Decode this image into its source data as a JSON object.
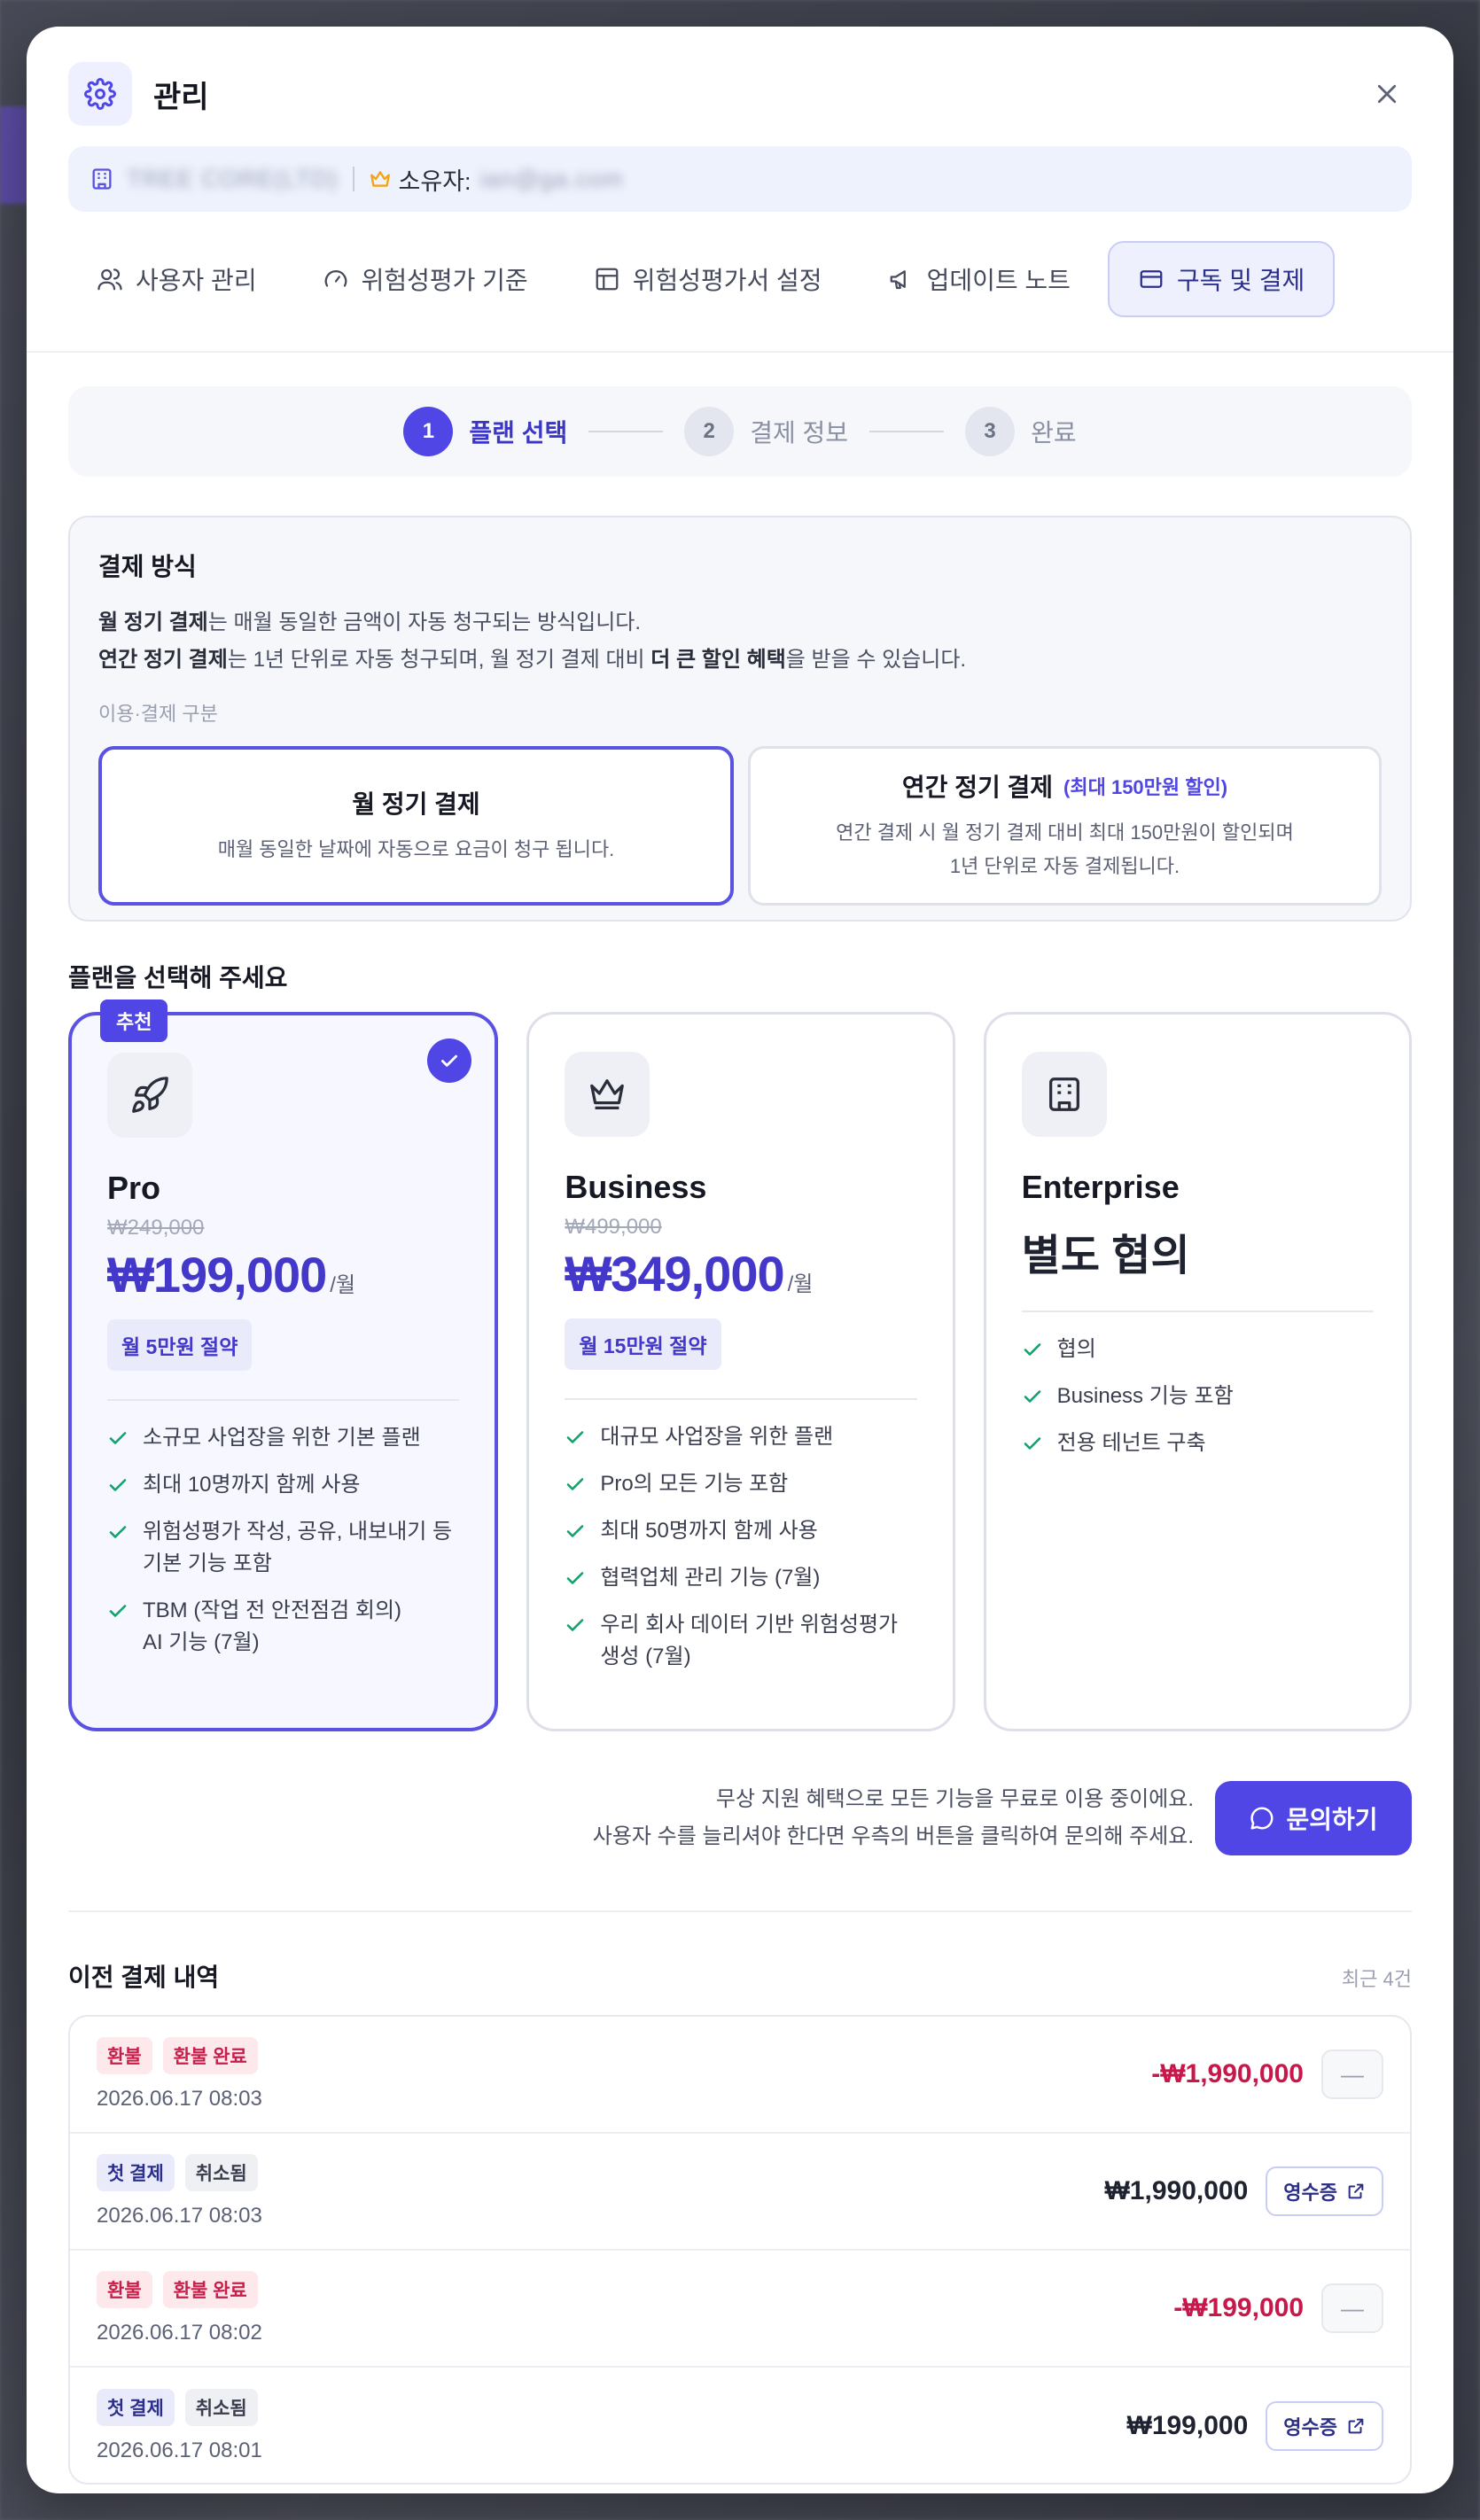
{
  "header": {
    "title": "관리",
    "owner_label": "소유자:",
    "org_blurred": "TREE CORE(LTD)",
    "owner_blurred": "ian@ga.com"
  },
  "tabs": [
    {
      "label": "사용자 관리",
      "icon": "users-icon",
      "active": false
    },
    {
      "label": "위험성평가 기준",
      "icon": "gauge-icon",
      "active": false
    },
    {
      "label": "위험성평가서 설정",
      "icon": "table-icon",
      "active": false
    },
    {
      "label": "업데이트 노트",
      "icon": "megaphone-icon",
      "active": false
    },
    {
      "label": "구독 및 결제",
      "icon": "credit-card-icon",
      "active": true
    }
  ],
  "stepper": [
    {
      "num": "1",
      "label": "플랜 선택",
      "active": true
    },
    {
      "num": "2",
      "label": "결제 정보",
      "active": false
    },
    {
      "num": "3",
      "label": "완료",
      "active": false
    }
  ],
  "payment": {
    "title": "결제 방식",
    "line1_bold": "월 정기 결제",
    "line1_rest": "는 매월 동일한 금액이 자동 청구되는 방식입니다.",
    "line2_bold": "연간 정기 결제",
    "line2_mid": "는 1년 단위로 자동 청구되며, 월 정기 결제 대비 ",
    "line2_bold2": "더 큰 할인 혜택",
    "line2_end": "을 받을 수 있습니다.",
    "label": "이용·결제 구분",
    "options": [
      {
        "title": "월 정기 결제",
        "badge": "",
        "sub1": "매월 동일한 날짜에 자동으로 요금이 청구 됩니다.",
        "sub2": "",
        "active": true
      },
      {
        "title": "연간 정기 결제",
        "badge": "(최대 150만원 할인)",
        "sub1": "연간 결제 시 월 정기 결제 대비 최대 150만원이 할인되며",
        "sub2": "1년 단위로 자동 결제됩니다.",
        "active": false
      }
    ]
  },
  "plans_title": "플랜을 선택해 주세요",
  "plans": [
    {
      "name": "Pro",
      "badge": "추천",
      "orig": "₩249,000",
      "price": "₩199,000",
      "per": "/월",
      "save": "월 5만원 절약",
      "icon": "rocket-icon",
      "selected": true,
      "features": [
        "소규모 사업장을 위한 기본 플랜",
        "최대 10명까지 함께 사용",
        "위험성평가 작성, 공유, 내보내기 등\n기본 기능 포함",
        "TBM (작업 전 안전점검 회의)\nAI 기능 (7월)"
      ]
    },
    {
      "name": "Business",
      "badge": "",
      "orig": "₩499,000",
      "price": "₩349,000",
      "per": "/월",
      "save": "월 15만원 절약",
      "icon": "crown-icon",
      "selected": false,
      "features": [
        "대규모 사업장을 위한 플랜",
        "Pro의 모든 기능 포함",
        "최대 50명까지 함께 사용",
        "협력업체 관리 기능 (7월)",
        "우리 회사 데이터 기반 위험성평가\n생성 (7월)"
      ]
    },
    {
      "name": "Enterprise",
      "badge": "",
      "custom": "별도 협의",
      "icon": "building-icon",
      "selected": false,
      "features": [
        "협의",
        "Business 기능 포함",
        "전용 테넌트 구축"
      ]
    }
  ],
  "support": {
    "line1": "무상 지원 혜택으로 모든 기능을 무료로 이용 중이에요.",
    "line2": "사용자 수를 늘리셔야 한다면 우측의 버튼을 클릭하여 문의해 주세요.",
    "button": "문의하기"
  },
  "history": {
    "title": "이전 결제 내역",
    "count": "최근 4건",
    "receipt_label": "영수증",
    "rows": [
      {
        "tags": [
          {
            "text": "환불",
            "style": "red"
          },
          {
            "text": "환불 완료",
            "style": "red"
          }
        ],
        "date": "2026.06.17 08:03",
        "amount": "-₩1,990,000",
        "negative": true,
        "receipt": false
      },
      {
        "tags": [
          {
            "text": "첫 결제",
            "style": "blue"
          },
          {
            "text": "취소됨",
            "style": "gray"
          }
        ],
        "date": "2026.06.17 08:03",
        "amount": "₩1,990,000",
        "negative": false,
        "receipt": true
      },
      {
        "tags": [
          {
            "text": "환불",
            "style": "red"
          },
          {
            "text": "환불 완료",
            "style": "red"
          }
        ],
        "date": "2026.06.17 08:02",
        "amount": "-₩199,000",
        "negative": true,
        "receipt": false
      },
      {
        "tags": [
          {
            "text": "첫 결제",
            "style": "blue"
          },
          {
            "text": "취소됨",
            "style": "gray"
          }
        ],
        "date": "2026.06.17 08:01",
        "amount": "₩199,000",
        "negative": false,
        "receipt": true
      }
    ]
  },
  "colors": {
    "accent": "#4f46e5",
    "negative": "#c8174a"
  }
}
